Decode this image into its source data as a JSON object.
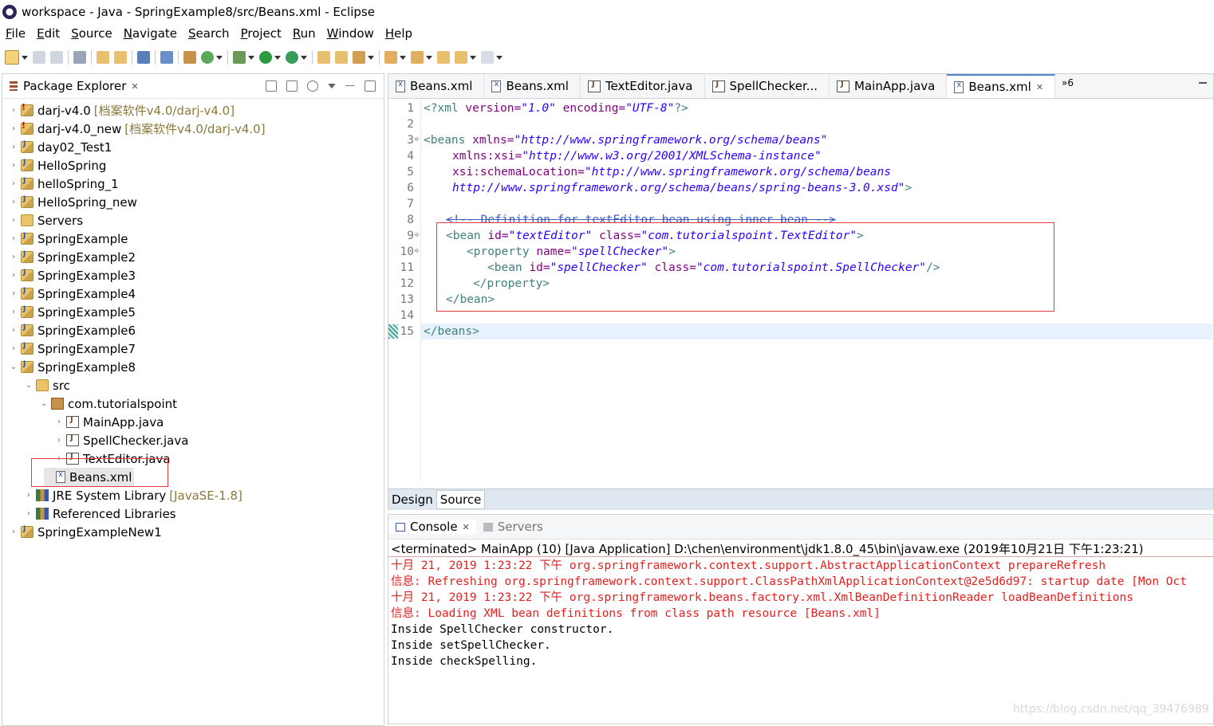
{
  "window": {
    "title": "workspace - Java - SpringExample8/src/Beans.xml - Eclipse"
  },
  "menu": [
    "File",
    "Edit",
    "Source",
    "Navigate",
    "Search",
    "Project",
    "Run",
    "Window",
    "Help"
  ],
  "package_explorer": {
    "title": "Package Explorer",
    "items": [
      {
        "label": "darj-v4.0",
        "decoration": "[档案软件v4.0/darj-v4.0]",
        "icon": "project-error-icon"
      },
      {
        "label": "darj-v4.0_new",
        "decoration": "[档案软件v4.0/darj-v4.0]",
        "icon": "project-error-icon"
      },
      {
        "label": "day02_Test1",
        "icon": "project-icon"
      },
      {
        "label": "HelloSpring",
        "icon": "project-icon"
      },
      {
        "label": "helloSpring_1",
        "icon": "project-icon"
      },
      {
        "label": "HelloSpring_new",
        "icon": "project-icon"
      },
      {
        "label": "Servers",
        "icon": "folder-icon"
      },
      {
        "label": "SpringExample",
        "icon": "project-icon"
      },
      {
        "label": "SpringExample2",
        "icon": "project-icon"
      },
      {
        "label": "SpringExample3",
        "icon": "project-icon"
      },
      {
        "label": "SpringExample4",
        "icon": "project-icon"
      },
      {
        "label": "SpringExample5",
        "icon": "project-icon"
      },
      {
        "label": "SpringExample6",
        "icon": "project-icon"
      },
      {
        "label": "SpringExample7",
        "icon": "project-icon"
      },
      {
        "label": "SpringExample8",
        "icon": "project-icon"
      },
      {
        "label": "src",
        "icon": "source-folder-icon"
      },
      {
        "label": "com.tutorialspoint",
        "icon": "package-icon"
      },
      {
        "label": "MainApp.java",
        "icon": "java-file-icon"
      },
      {
        "label": "SpellChecker.java",
        "icon": "java-file-icon"
      },
      {
        "label": "TextEditor.java",
        "icon": "java-file-icon"
      },
      {
        "label": "Beans.xml",
        "icon": "xml-file-icon"
      },
      {
        "label": "JRE System Library",
        "decoration": "[JavaSE-1.8]",
        "icon": "library-icon"
      },
      {
        "label": "Referenced Libraries",
        "icon": "library-icon"
      },
      {
        "label": "SpringExampleNew1",
        "icon": "project-icon"
      }
    ]
  },
  "editor": {
    "tabs": [
      {
        "label": "Beans.xml",
        "icon": "xml-file-icon"
      },
      {
        "label": "Beans.xml",
        "icon": "xml-file-icon"
      },
      {
        "label": "TextEditor.java",
        "icon": "java-file-icon"
      },
      {
        "label": "SpellChecker...",
        "icon": "java-file-icon"
      },
      {
        "label": "MainApp.java",
        "icon": "java-file-icon"
      },
      {
        "label": "Beans.xml",
        "icon": "xml-file-icon",
        "active": true
      }
    ],
    "more_tabs": "»6",
    "line_numbers": [
      "1",
      "2",
      "3",
      "4",
      "5",
      "6",
      "7",
      "8",
      "9",
      "10",
      "11",
      "12",
      "13",
      "14",
      "15"
    ],
    "lines": {
      "l1": {
        "open": "<?xml ",
        "a1": "version=",
        "v1": "\"1.0\"",
        "a2": " encoding=",
        "v2": "\"UTF-8\"",
        "close": "?>"
      },
      "l3": {
        "open": "<beans ",
        "a1": "xmlns=",
        "v1": "\"http://www.springframework.org/schema/beans\""
      },
      "l4": {
        "a1": "xmlns:xsi=",
        "v1": "\"http://www.w3.org/2001/XMLSchema-instance\""
      },
      "l5": {
        "a1": "xsi:schemaLocation=",
        "v1": "\"http://www.springframework.org/schema/beans"
      },
      "l6": {
        "v1": "http://www.springframework.org/schema/beans/spring-beans-3.0.xsd\"",
        "close": ">"
      },
      "l8": {
        "comment": "<!-- Definition for textEditor bean using inner bean -->"
      },
      "l9": {
        "open": "<bean ",
        "a1": "id=",
        "v1": "\"textEditor\"",
        "a2": " class=",
        "v2": "\"com.tutorialspoint.TextEditor\"",
        "close": ">"
      },
      "l10": {
        "open": "<property ",
        "a1": "name=",
        "v1": "\"spellChecker\"",
        "close": ">"
      },
      "l11": {
        "open": "<bean ",
        "a1": "id=",
        "v1": "\"spellChecker\"",
        "a2": " class=",
        "v2": "\"com.tutorialspoint.SpellChecker\"",
        "close": "/>"
      },
      "l12": {
        "close": "</property>"
      },
      "l13": {
        "close": "</bean>"
      },
      "l15": {
        "close": "</beans>"
      }
    },
    "bottom_tabs": [
      "Design",
      "Source"
    ]
  },
  "console": {
    "tabs": [
      {
        "label": "Console",
        "icon": "console-icon"
      },
      {
        "label": "Servers",
        "icon": "servers-icon"
      }
    ],
    "header": "<terminated> MainApp (10) [Java Application] D:\\chen\\environment\\jdk1.8.0_45\\bin\\javaw.exe (2019年10月21日 下午1:23:21)",
    "lines": [
      {
        "text": "十月 21, 2019 1:23:22 下午 org.springframework.context.support.AbstractApplicationContext prepareRefresh",
        "type": "err"
      },
      {
        "text": "信息: Refreshing org.springframework.context.support.ClassPathXmlApplicationContext@2e5d6d97: startup date [Mon Oct",
        "type": "err"
      },
      {
        "text": "十月 21, 2019 1:23:22 下午 org.springframework.beans.factory.xml.XmlBeanDefinitionReader loadBeanDefinitions",
        "type": "err"
      },
      {
        "text": "信息: Loading XML bean definitions from class path resource [Beans.xml]",
        "type": "err"
      },
      {
        "text": "Inside SpellChecker constructor.",
        "type": "out"
      },
      {
        "text": "Inside setSpellChecker.",
        "type": "out"
      },
      {
        "text": "Inside checkSpelling.",
        "type": "out"
      }
    ],
    "watermark": "https://blog.csdn.net/qq_39476989"
  },
  "colors": {
    "highlight_box": "#e5393f",
    "error_text": "#e5201f",
    "xml_tag": "#3f7f7f",
    "xml_attr": "#7f007f",
    "xml_value": "#2a00ff"
  }
}
